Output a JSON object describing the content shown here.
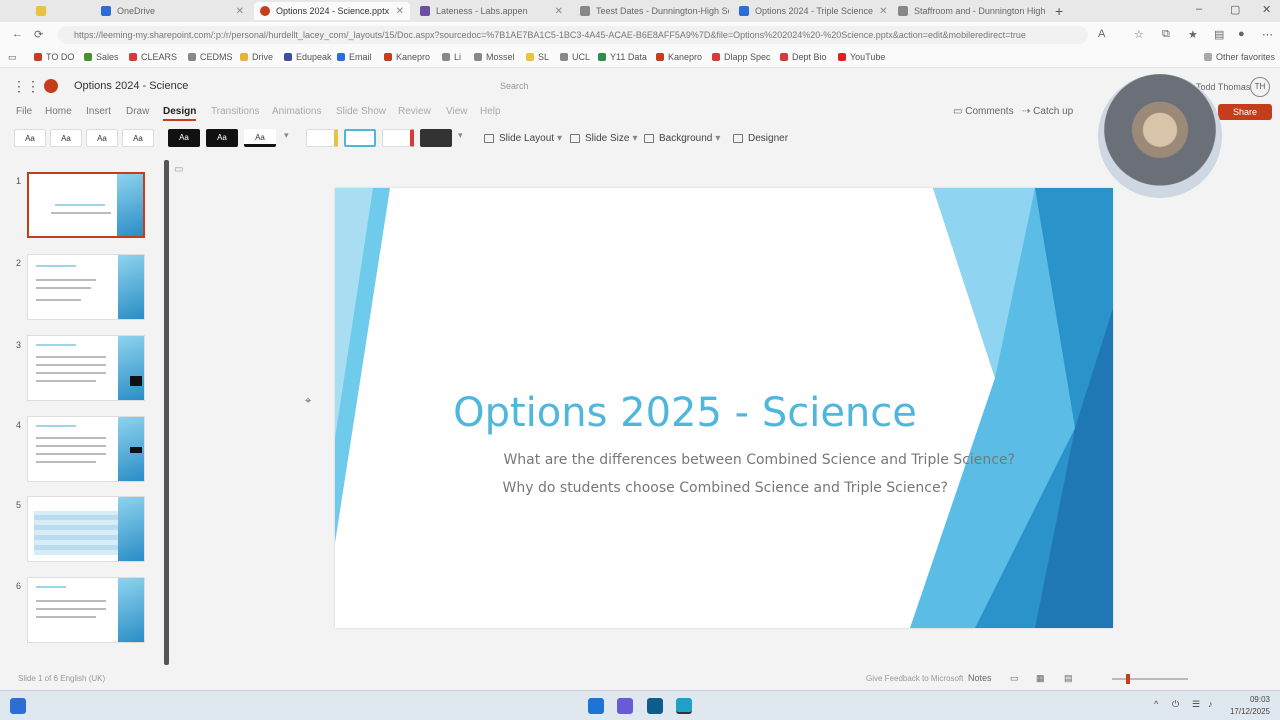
{
  "browser": {
    "tabs": [
      {
        "label": "",
        "color": "#e8c341"
      },
      {
        "label": "OneDrive",
        "color": "#2b6fd6"
      },
      {
        "label": "Options 2024 - Science.pptx",
        "color": "#c43e1c",
        "active": true
      },
      {
        "label": "Lateness - Labs.appen",
        "color": "#6c4ea3"
      },
      {
        "label": "Teest Dates - Dunnington-High Sc",
        "color": "#888888"
      },
      {
        "label": "Options 2024 - Triple Science",
        "color": "#2b6fd6"
      },
      {
        "label": "Staffroom and - Dunnington High",
        "color": "#888888"
      }
    ],
    "url": "https://leeming-my.sharepoint.com/:p:/r/personal/hurdellt_lacey_com/_layouts/15/Doc.aspx?sourcedoc=%7B1AE7BA1C5-1BC3-4A45-ACAE-B6E8AFF5A9%7D&file=Options%202024%20-%20Science.pptx&action=edit&mobileredirect=true",
    "bookmarks": [
      "TO DO",
      "Sales",
      "CLEARS",
      "CEDMS",
      "Drive",
      "Edupeak",
      "Email",
      "Kanepro",
      "Li",
      "Mossel",
      "SL",
      "UCL",
      "Y11 Data",
      "Kanepro",
      "Dlapp Spec",
      "Dept Bio",
      "YouTube"
    ],
    "other_favorites": "Other favorites"
  },
  "app": {
    "doc_title": "Options 2024 - Science",
    "search_placeholder": "Search",
    "user_name": "Todd Thomas",
    "user_initials": "TH"
  },
  "ribbon": {
    "tabs": [
      "File",
      "Home",
      "Insert",
      "Draw",
      "Design",
      "Transitions",
      "Animations",
      "Slide Show",
      "Review",
      "View",
      "Help"
    ],
    "active_tab": "Design",
    "comments": "Comments",
    "catch_up": "Catch up",
    "share": "Share",
    "themes": [
      "Aa",
      "Aa",
      "Aa",
      "Aa",
      "Aa",
      "Aa",
      "Aa"
    ],
    "slide_layout": "Slide Layout",
    "slide_size": "Slide Size",
    "background": "Background",
    "designer": "Designer"
  },
  "slides": {
    "numbers": [
      "1",
      "2",
      "3",
      "4",
      "5",
      "6"
    ],
    "selected": 1
  },
  "slide": {
    "title": "Options 2025 - Science",
    "subtitle_1": "What are the differences between Combined Science and Triple Science?",
    "subtitle_2": "Why do students choose Combined Science and Triple Science?",
    "accent_color": "#4fb6dc"
  },
  "statusbar": {
    "left": "Slide 1 of 6    English (UK)",
    "feedback": "Give Feedback to Microsoft",
    "notes": "Notes"
  },
  "taskbar": {
    "time": "09:03",
    "date": "17/12/2025"
  }
}
